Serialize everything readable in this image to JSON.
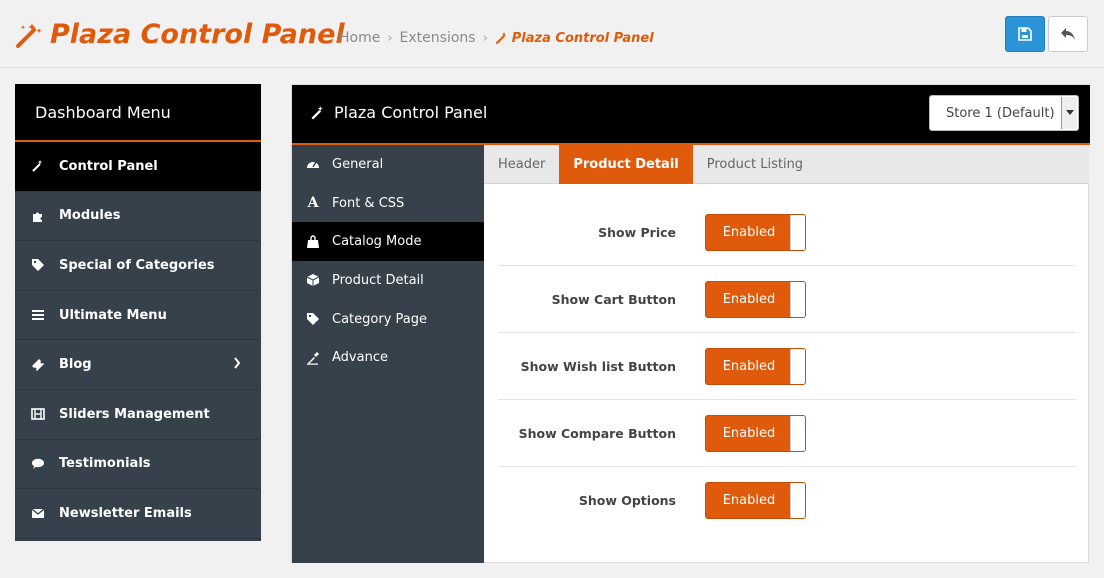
{
  "header": {
    "title": "Plaza Control Panel",
    "breadcrumb": [
      "Home",
      "Extensions",
      "Plaza Control Panel"
    ],
    "save_icon": "save-icon",
    "back_icon": "reply-icon"
  },
  "dashboard_menu": {
    "title": "Dashboard Menu",
    "items": [
      {
        "label": "Control Panel",
        "icon": "wand-icon",
        "active": true
      },
      {
        "label": "Modules",
        "icon": "puzzle-icon"
      },
      {
        "label": "Special of Categories",
        "icon": "tag-icon"
      },
      {
        "label": "Ultimate Menu",
        "icon": "bars-icon"
      },
      {
        "label": "Blog",
        "icon": "ticket-icon",
        "has_submenu": true
      },
      {
        "label": "Sliders Management",
        "icon": "film-icon"
      },
      {
        "label": "Testimonials",
        "icon": "comment-icon"
      },
      {
        "label": "Newsletter Emails",
        "icon": "envelope-icon"
      }
    ]
  },
  "panel": {
    "title": "Plaza Control Panel",
    "store_select": "Store 1 (Default)",
    "subnav": [
      {
        "label": "General",
        "icon": "dashboard-icon"
      },
      {
        "label": "Font & CSS",
        "icon": "font-icon"
      },
      {
        "label": "Catalog Mode",
        "icon": "shopping-bag-icon",
        "active": true
      },
      {
        "label": "Product Detail",
        "icon": "cube-icon"
      },
      {
        "label": "Category Page",
        "icon": "tags-icon"
      },
      {
        "label": "Advance",
        "icon": "eyedropper-icon"
      }
    ],
    "tabs": [
      {
        "label": "Header"
      },
      {
        "label": "Product Detail",
        "active": true
      },
      {
        "label": "Product Listing"
      }
    ],
    "settings": [
      {
        "label": "Show Price",
        "value": "Enabled"
      },
      {
        "label": "Show Cart Button",
        "value": "Enabled"
      },
      {
        "label": "Show Wish list Button",
        "value": "Enabled"
      },
      {
        "label": "Show Compare Button",
        "value": "Enabled"
      },
      {
        "label": "Show Options",
        "value": "Enabled"
      }
    ]
  },
  "colors": {
    "accent": "#e05a0c",
    "primary_button": "#2b94d6",
    "sidebar": "#37414b",
    "header_bar": "#000000"
  }
}
